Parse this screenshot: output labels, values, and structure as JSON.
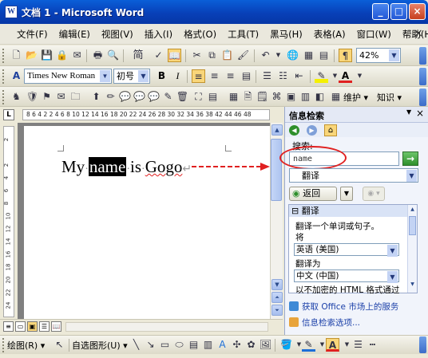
{
  "window": {
    "title": "文档 1 - Microsoft Word",
    "app_icon": "W",
    "minimize": "_",
    "maximize": "□",
    "close": "×"
  },
  "menu": {
    "items": [
      "文件(F)",
      "编辑(E)",
      "视图(V)",
      "插入(I)",
      "格式(O)",
      "工具(T)",
      "黑马(H)",
      "表格(A)",
      "窗口(W)",
      "帮助(H)"
    ],
    "close_doc": "×"
  },
  "toolbar_standard": {
    "font_box": "简",
    "zoom": "42%"
  },
  "toolbar_format": {
    "font_name": "Times New Roman",
    "font_size": "初号",
    "bold": "B",
    "italic": "I"
  },
  "toolbar_custom": {
    "maintain": "维护",
    "knowledge": "知识"
  },
  "ruler": {
    "corner": "L",
    "numbers": "8 6 4 2  2 4 6 8 10 12 14 16 18 20 22 24 26 28 30 32 34 36 38    42 44 46 48",
    "vertical_numbers": [
      "2",
      "2",
      "4",
      "6",
      "8",
      "10",
      "12",
      "14",
      "16",
      "18",
      "20",
      "22",
      "24",
      "26",
      "28"
    ]
  },
  "document": {
    "word1": "My",
    "selected": "name",
    "word3": "is",
    "word4": "Gogo",
    "para_mark": "↵"
  },
  "task_pane": {
    "title": "信息检索",
    "search_label": "搜索:",
    "search_value": "name",
    "go": "→",
    "service": "翻译",
    "back": "返回",
    "result_header": "翻译",
    "result_lines": {
      "desc": "翻译一个单词或句子。",
      "from_label": "将",
      "from_value": "英语 (美国)",
      "to_label": "翻译为",
      "to_value": "中文 (中国)",
      "note": "以不加密的 HTML 格式通过"
    },
    "links": [
      "获取 Office 市场上的服务",
      "信息检索选项..."
    ]
  },
  "draw_toolbar": {
    "draw": "绘图(R)",
    "autoshapes": "自选图形(U)"
  }
}
